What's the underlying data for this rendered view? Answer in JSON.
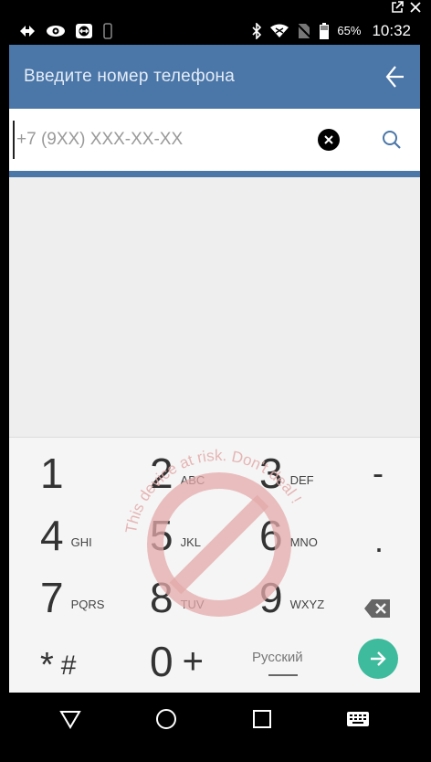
{
  "status_bar": {
    "battery": "65%",
    "time": "10:32"
  },
  "app_bar": {
    "title": "Введите номер телефона"
  },
  "search": {
    "placeholder": "+7 (9XX) XXX-XX-XX",
    "value": ""
  },
  "keypad": {
    "keys": [
      {
        "digit": "1",
        "letters": ""
      },
      {
        "digit": "2",
        "letters": "ABC"
      },
      {
        "digit": "3",
        "letters": "DEF"
      },
      {
        "digit": "4",
        "letters": "GHI"
      },
      {
        "digit": "5",
        "letters": "JKL"
      },
      {
        "digit": "6",
        "letters": "MNO"
      },
      {
        "digit": "7",
        "letters": "PQRS"
      },
      {
        "digit": "8",
        "letters": "TUV"
      },
      {
        "digit": "9",
        "letters": "WXYZ"
      },
      {
        "digit": "0",
        "letters": ""
      }
    ],
    "dash": "-",
    "dot": ".",
    "star": "*",
    "hash": "#",
    "plus": "+",
    "language": "Русский"
  },
  "watermark": {
    "text": "This device at risk. Don't deal !"
  },
  "colors": {
    "app_bar": "#4a76a8",
    "accent": "#3dbb9c",
    "watermark": "#e0a0a0"
  }
}
